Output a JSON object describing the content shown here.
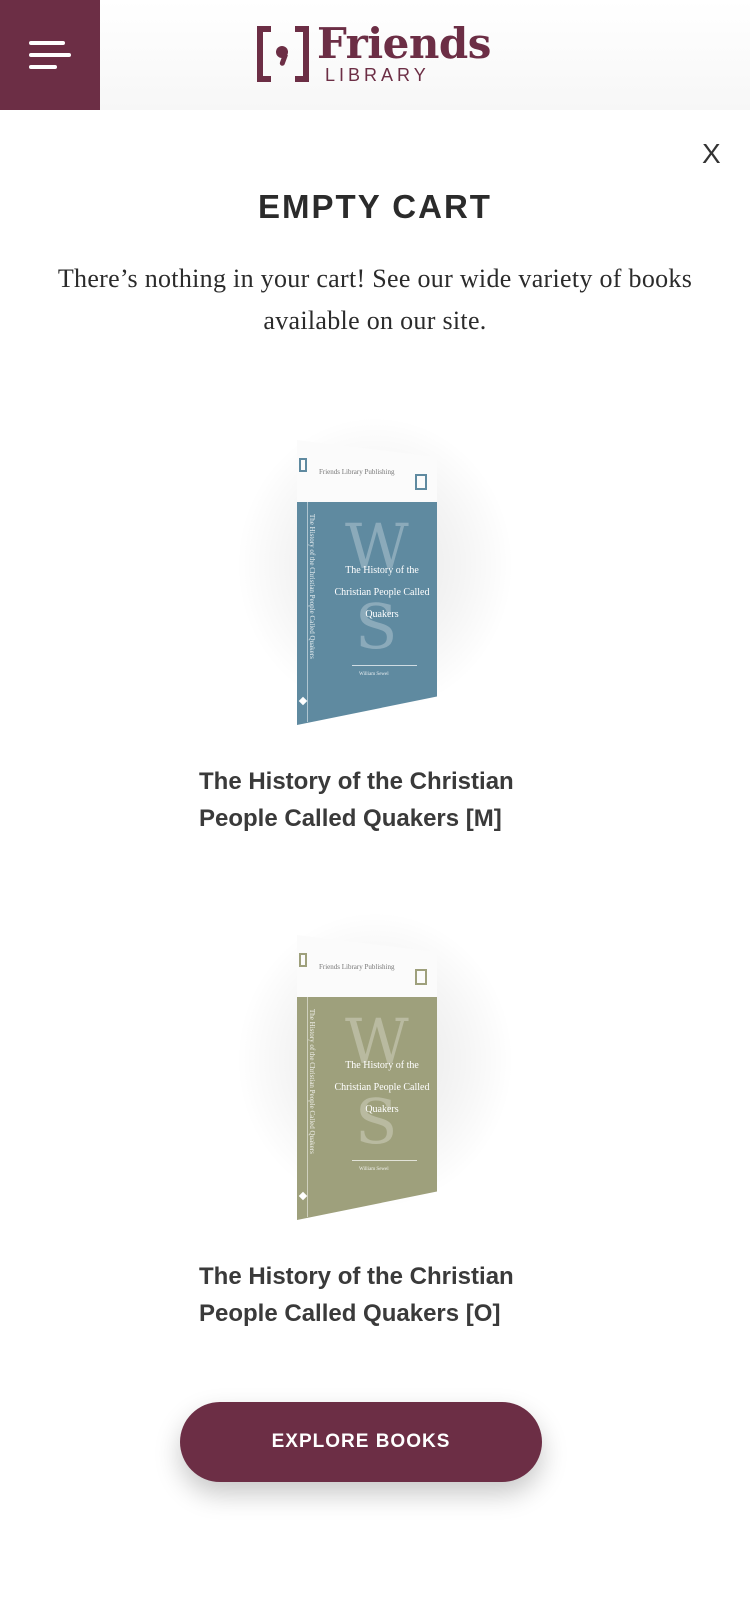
{
  "header": {
    "menu_icon": "hamburger-menu-icon",
    "logo": {
      "title": "Friends",
      "subtitle": "LIBRARY"
    },
    "brand_color": "#6c2e45"
  },
  "modal": {
    "close_label": "X",
    "title": "EMPTY CART",
    "description": "There’s nothing in your cart! See our wide variety of books available on our site."
  },
  "books": [
    {
      "title": "The History of the Christian People Called Quakers [M]",
      "cover_title": "The History of the Christian People Called Quakers",
      "cover_color": "#5f8aa0",
      "publisher": "Friends Library Publishing",
      "author": "William Sewel",
      "monogram_top": "W",
      "monogram_bottom": "S"
    },
    {
      "title": "The History of the Christian People Called Quakers [O]",
      "cover_title": "The History of the Christian People Called Quakers",
      "cover_color": "#9ea07c",
      "publisher": "Friends Library Publishing",
      "author": "William Sewel",
      "monogram_top": "W",
      "monogram_bottom": "S"
    }
  ],
  "cta": {
    "label": "EXPLORE BOOKS"
  }
}
